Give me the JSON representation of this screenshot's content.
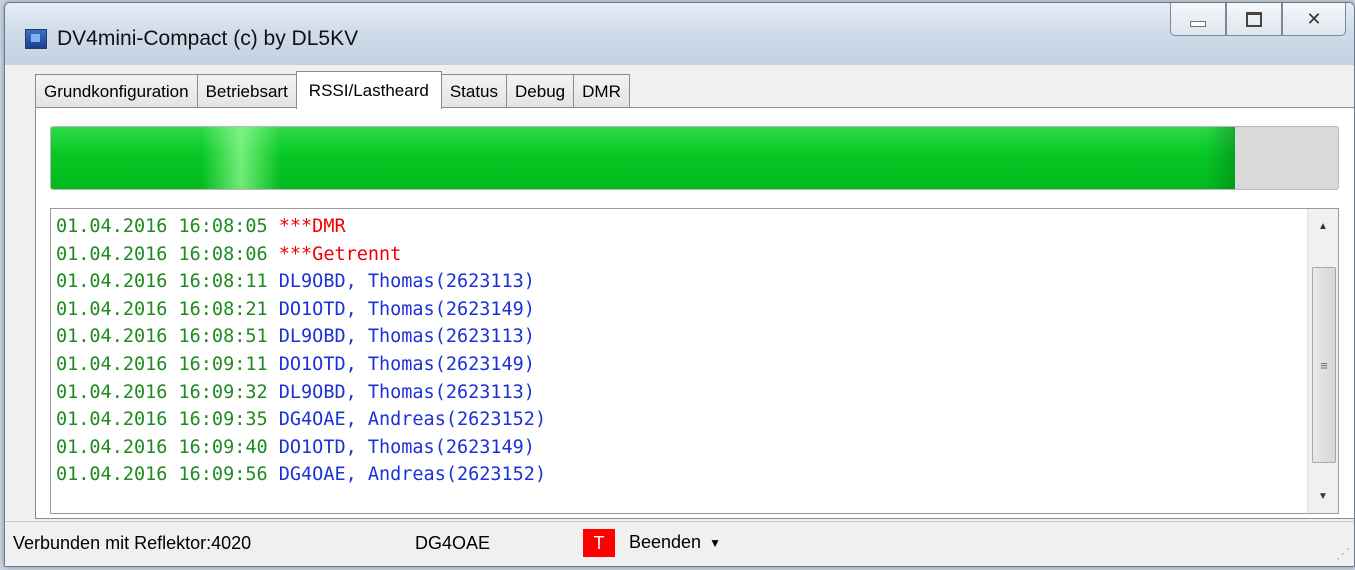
{
  "window": {
    "title": "DV4mini-Compact (c) by DL5KV"
  },
  "tabs": [
    {
      "label": "Grundkonfiguration"
    },
    {
      "label": "Betriebsart"
    },
    {
      "label": "RSSI/Lastheard"
    },
    {
      "label": "Status"
    },
    {
      "label": "Debug"
    },
    {
      "label": "DMR"
    }
  ],
  "active_tab": "RSSI/Lastheard",
  "rssi": {
    "level_fraction": 0.92,
    "color": "#06c823"
  },
  "log": [
    {
      "timestamp": "01.04.2016 16:08:05",
      "message": "***DMR",
      "color": "red"
    },
    {
      "timestamp": "01.04.2016 16:08:06",
      "message": "***Getrennt",
      "color": "red"
    },
    {
      "timestamp": "01.04.2016 16:08:11",
      "message": "DL9OBD, Thomas(2623113)",
      "color": "blue"
    },
    {
      "timestamp": "01.04.2016 16:08:21",
      "message": "DO1OTD, Thomas(2623149)",
      "color": "blue"
    },
    {
      "timestamp": "01.04.2016 16:08:51",
      "message": "DL9OBD, Thomas(2623113)",
      "color": "blue"
    },
    {
      "timestamp": "01.04.2016 16:09:11",
      "message": "DO1OTD, Thomas(2623149)",
      "color": "blue"
    },
    {
      "timestamp": "01.04.2016 16:09:32",
      "message": "DL9OBD, Thomas(2623113)",
      "color": "blue"
    },
    {
      "timestamp": "01.04.2016 16:09:35",
      "message": "DG4OAE, Andreas(2623152)",
      "color": "blue"
    },
    {
      "timestamp": "01.04.2016 16:09:40",
      "message": "DO1OTD, Thomas(2623149)",
      "color": "blue"
    },
    {
      "timestamp": "01.04.2016 16:09:56",
      "message": "DG4OAE, Andreas(2623152)",
      "color": "blue"
    }
  ],
  "statusbar": {
    "connection": "Verbunden mit Reflektor:4020",
    "callsign": "DG4OAE",
    "t_badge": "T",
    "exit_label": "Beenden"
  },
  "icons": {
    "app": "app-icon",
    "minimize": "minimize-icon",
    "maximize": "maximize-icon",
    "close": "close-icon",
    "dropdown": "chevron-down-icon"
  }
}
